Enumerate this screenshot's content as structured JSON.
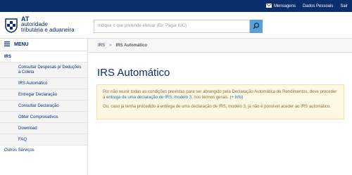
{
  "topbar": {
    "links": [
      {
        "label": "Mensagens",
        "icon": "envelope-icon"
      },
      {
        "label": "Dados Pessoais",
        "icon": ""
      },
      {
        "label": "Sair",
        "icon": ""
      }
    ]
  },
  "logo": {
    "line1": "AT",
    "line2": "autoridade",
    "line3": "tributária e aduaneira"
  },
  "search": {
    "placeholder": "Indique o que pretende efetuar (Ex: Pagar IUC)"
  },
  "sidebar": {
    "menu_label": "MENU",
    "section": "IRS",
    "items": [
      {
        "label": "Consultar Despesas p/ Deduções à Coleta"
      },
      {
        "label": "IRS Automático"
      },
      {
        "label": "Entregar Declaração"
      },
      {
        "label": "Consultar Declaração"
      },
      {
        "label": "Obter Comprovativos"
      },
      {
        "label": "Download"
      },
      {
        "label": "FAQ"
      }
    ],
    "footer": "Outros Serviços"
  },
  "breadcrumb": {
    "root": "IRS",
    "separator": ">",
    "current": "IRS Automático"
  },
  "main": {
    "title": "IRS Automático",
    "alert": {
      "p1_text1": "Por não reunir todas as condições previstas para ser abrangido pela Declaração Automática de Rendimentos, deve proceder à ",
      "p1_link": "entrega de uma declaração de IRS, modelo 3",
      "p1_text2": ", nos termos gerais. ",
      "p1_info": "(+ info)",
      "p2": "Ou, caso já tenha procedido à entrega de uma declaração de IRS, modelo 3, já não é possível aceder ao IRS automático."
    }
  },
  "colors": {
    "brand": "#0a2d6b",
    "search_button": "#5aa0d6",
    "alert_bg": "#fcf8e3",
    "alert_text": "#8a6d3b"
  }
}
